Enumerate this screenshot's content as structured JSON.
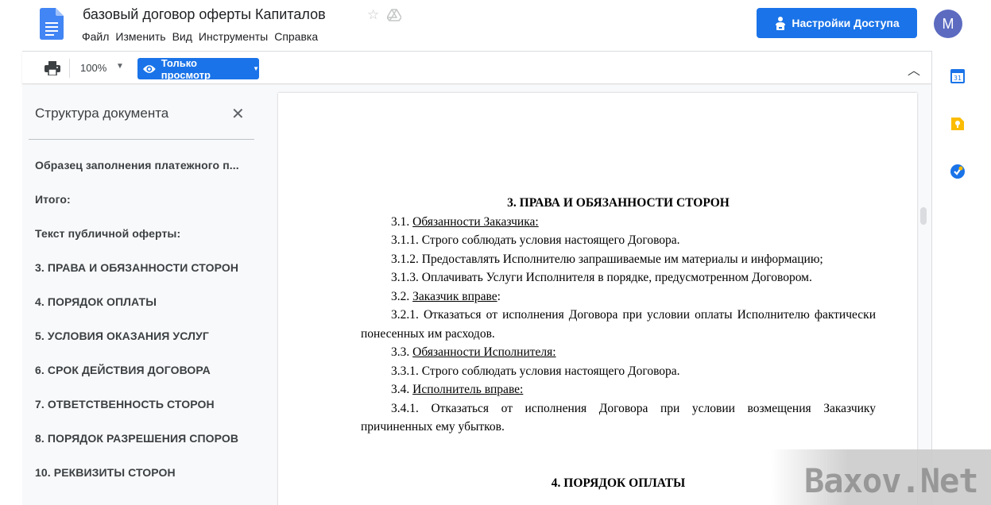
{
  "header": {
    "title": "базовый договор оферты Капиталов",
    "menu": [
      "Файл",
      "Изменить",
      "Вид",
      "Инструменты",
      "Справка"
    ],
    "share_label": "Настройки Доступа",
    "avatar_letter": "M",
    "star_icon": "star-icon",
    "drive_icon": "drive-icon"
  },
  "toolbar": {
    "zoom": "100%",
    "view_mode": "Только просмотр"
  },
  "outline": {
    "title": "Структура документа",
    "items": [
      "Образец заполнения платежного п...",
      "Итого:",
      "Текст публичной оферты:",
      "3. ПРАВА И ОБЯЗАННОСТИ СТОРОН",
      "4. ПОРЯДОК ОПЛАТЫ",
      "5. УСЛОВИЯ ОКАЗАНИЯ УСЛУГ",
      "6. СРОК ДЕЙСТВИЯ ДОГОВОРА",
      "7. ОТВЕТСТВЕННОСТЬ СТОРОН",
      "8. ПОРЯДОК РАЗРЕШЕНИЯ СПОРОВ",
      "10. РЕКВИЗИТЫ СТОРОН"
    ]
  },
  "document": {
    "heading3": "3. ПРАВА И ОБЯЗАННОСТИ СТОРОН",
    "p31_num": "3.1. ",
    "p31_u": "Обязанности Заказчика:",
    "p311": "3.1.1. Строго соблюдать условия настоящего Договора.",
    "p312": "3.1.2. Предоставлять Исполнителю запрашиваемые им материалы и информацию;",
    "p313": "3.1.3. Оплачивать Услуги Исполнителя в порядке, предусмотренном Договором.",
    "p32_num": "3.2. ",
    "p32_u": "Заказчик вправе",
    "p32_tail": ":",
    "p321": "3.2.1. Отказаться от исполнения Договора при условии оплаты Исполнителю фактически понесенных им расходов.",
    "p33_num": "3.3. ",
    "p33_u": "Обязанности Исполнителя:",
    "p331": "3.3.1. Строго соблюдать условия настоящего Договора.",
    "p34_num": "3.4. ",
    "p34_u": "Исполнитель вправе:",
    "p341": "3.4.1. Отказаться от исполнения Договора при условии возмещения Заказчику причиненных ему убытков.",
    "heading4": "4. ПОРЯДОК ОПЛАТЫ"
  },
  "watermark": "Baxov.Net"
}
